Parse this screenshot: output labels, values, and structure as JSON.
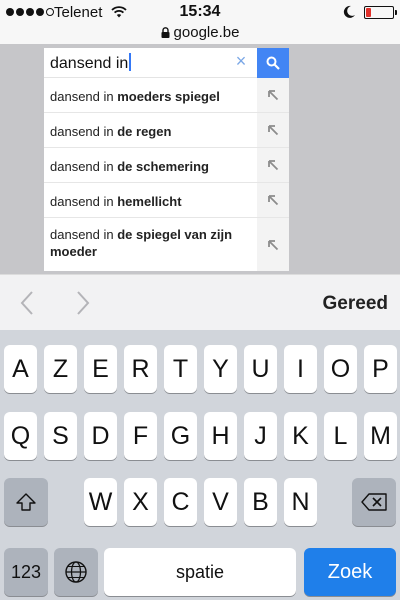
{
  "status": {
    "carrier": "Telenet",
    "time": "15:34",
    "battery_level": 0.2,
    "battery_color": "#e0302a",
    "signal_bars": 4,
    "signal_total": 5
  },
  "browser": {
    "url": "google.be"
  },
  "search": {
    "query": "dansend in",
    "button_color": "#4285f4",
    "suggestions": [
      {
        "prefix": "dansend in ",
        "bold": "moeders spiegel"
      },
      {
        "prefix": "dansend in ",
        "bold": "de regen"
      },
      {
        "prefix": "dansend in ",
        "bold": "de schemering"
      },
      {
        "prefix": "dansend in ",
        "bold": "hemellicht"
      },
      {
        "prefix": "dansend in ",
        "bold": "de spiegel van zijn moeder"
      }
    ]
  },
  "accessory_bar": {
    "done_label": "Gereed"
  },
  "keyboard": {
    "row1": [
      "A",
      "Z",
      "E",
      "R",
      "T",
      "Y",
      "U",
      "I",
      "O",
      "P"
    ],
    "row2": [
      "Q",
      "S",
      "D",
      "F",
      "G",
      "H",
      "J",
      "K",
      "L",
      "M"
    ],
    "row3": [
      "W",
      "X",
      "C",
      "V",
      "B",
      "N"
    ],
    "numbers_label": "123",
    "space_label": "spatie",
    "search_label": "Zoek",
    "search_key_color": "#1f7fea"
  }
}
